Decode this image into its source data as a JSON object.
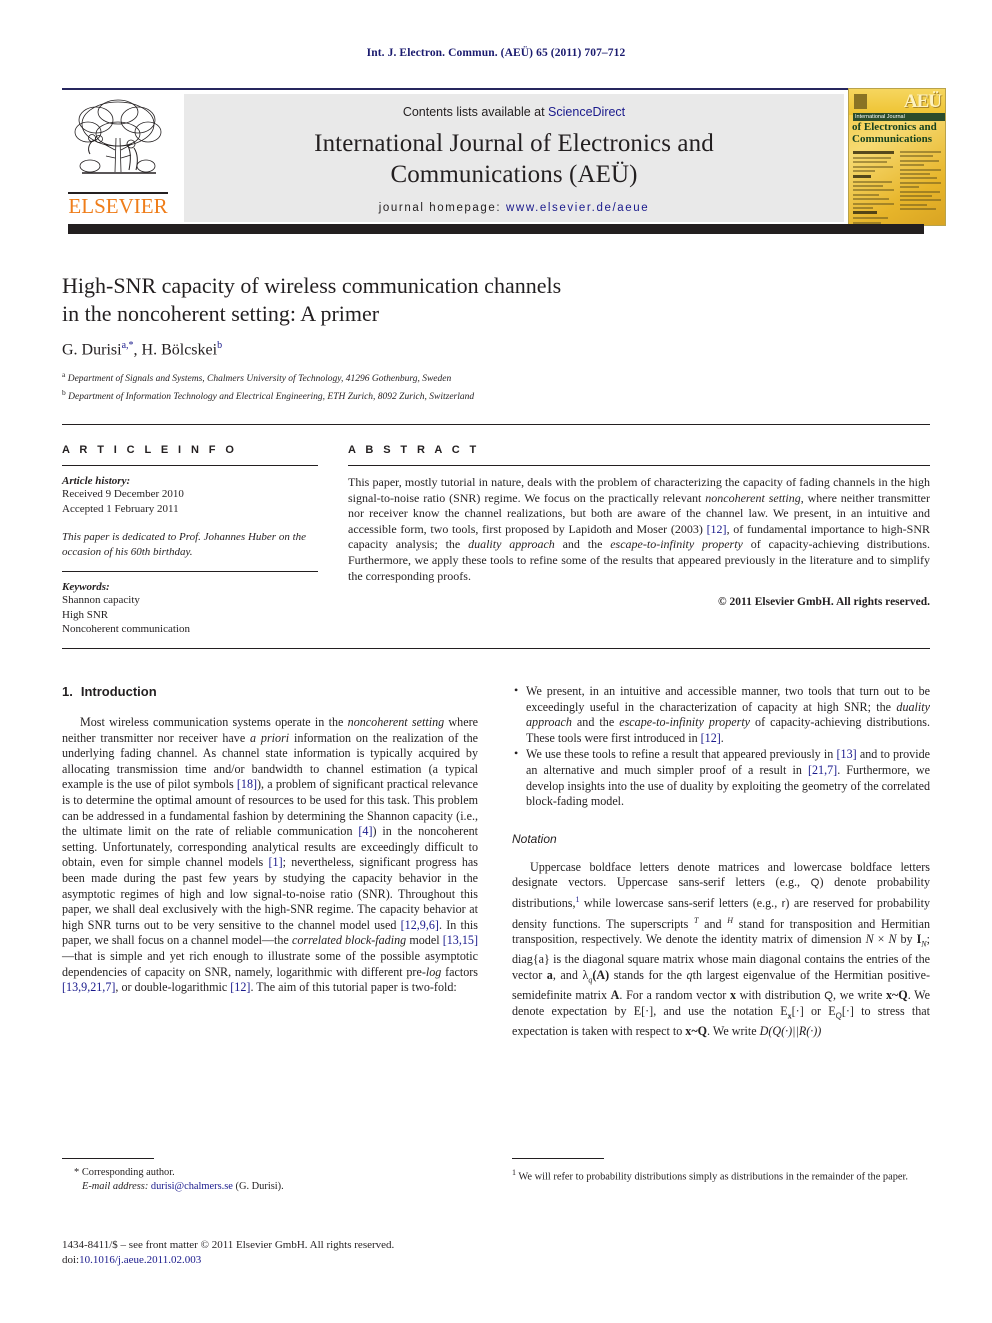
{
  "running_head": "Int. J. Electron. Commun. (AEÜ) 65 (2011) 707–712",
  "masthead": {
    "contents_prefix": "Contents lists available at ",
    "sciencedirect": "ScienceDirect",
    "journal_title_line1": "International Journal of Electronics and",
    "journal_title_line2": "Communications (AEÜ)",
    "homepage_prefix": "journal homepage: ",
    "homepage_url": "www.elsevier.de/aeue",
    "publisher_wordmark": "ELSEVIER",
    "cover": {
      "logo_text": "AEÜ",
      "banner_text": "International Journal",
      "title_line1": "of Electronics and",
      "title_line2": "Communications",
      "contents_label": "Contents"
    }
  },
  "article": {
    "title_line1": "High-SNR capacity of wireless communication channels",
    "title_line2": "in the noncoherent setting: A primer",
    "authors": "G. Durisi",
    "author_sup_a": "a,*",
    "authors_cont": ", H. Bölcskei",
    "author_sup_b": "b",
    "affiliation_a_sup": "a",
    "affiliation_a": "Department of Signals and Systems, Chalmers University of Technology, 41296 Gothenburg, Sweden",
    "affiliation_b_sup": "b",
    "affiliation_b": "Department of Information Technology and Electrical Engineering, ETH Zurich, 8092 Zurich, Switzerland"
  },
  "info": {
    "heading": "A R T I C L E    I N F O",
    "history_label": "Article history:",
    "received": "Received 9 December 2010",
    "accepted": "Accepted 1 February 2011",
    "dedication": "This paper is dedicated to Prof. Johannes Huber on the occasion of his 60th birthday.",
    "keywords_label": "Keywords:",
    "keywords": [
      "Shannon capacity",
      "High SNR",
      "Noncoherent communication"
    ]
  },
  "abstract": {
    "heading": "A B S T R A C T",
    "p1_a": "This paper, mostly tutorial in nature, deals with the problem of characterizing the capacity of fading channels in the high signal-to-noise ratio (SNR) regime. We focus on the practically relevant ",
    "p1_i1": "noncoherent setting",
    "p1_b": ", where neither transmitter nor receiver know the channel realizations, but both are aware of the channel law. We present, in an intuitive and accessible form, two tools, first proposed by Lapidoth and Moser (2003) ",
    "p1_ref1": "[12]",
    "p1_c": ", of fundamental importance to high-SNR capacity analysis; the ",
    "p1_i2": "duality approach",
    "p1_d": " and the ",
    "p1_i3": "escape-to-infinity property",
    "p1_e": " of capacity-achieving distributions. Furthermore, we apply these tools to refine some of the results that appeared previously in the literature and to simplify the corresponding proofs.",
    "copyright": "© 2011 Elsevier GmbH. All rights reserved."
  },
  "intro": {
    "number": "1.",
    "heading": "Introduction",
    "p1_a": "Most wireless communication systems operate in the ",
    "p1_i1": "noncoherent setting",
    "p1_b": " where neither transmitter nor receiver have ",
    "p1_i2": "a priori",
    "p1_c": " information on the realization of the underlying fading channel. As channel state information is typically acquired by allocating transmission time and/or bandwidth to channel estimation (a typical example is the use of pilot symbols ",
    "p1_ref18": "[18]",
    "p1_d": "), a problem of significant practical relevance is to determine the optimal amount of resources to be used for this task. This problem can be addressed in a fundamental fashion by determining the Shannon capacity (i.e., the ultimate limit on the rate of reliable communication ",
    "p1_ref4": "[4]",
    "p1_e": ") in the noncoherent setting. Unfortunately, corresponding analytical results are exceedingly difficult to obtain, even for simple channel models ",
    "p1_ref1": "[1]",
    "p1_f": "; nevertheless, significant progress has been made during the past few years by studying the capacity behavior in the asymptotic regimes of high and low signal-to-noise ratio (SNR). Throughout this paper, we shall deal exclusively with the high-SNR regime. The capacity behavior at high SNR turns out to be very sensitive to the channel model used ",
    "p1_ref1296": "[12,9,6]",
    "p1_g": ". In this paper, we shall focus on a channel model—the ",
    "p1_i3": "correlated block-fading",
    "p1_h": " model ",
    "p1_ref1315": "[13,15]",
    "p1_j": "—that is simple and yet rich enough to illustrate some of the possible asymptotic dependencies of capacity on SNR, namely, logarithmic with different pre-",
    "p1_i4": "log",
    "p1_k": " factors ",
    "p1_ref13921": "[13,9,21,7]",
    "p1_l": ", or double-logarithmic ",
    "p1_ref12b": "[12]",
    "p1_m": ". The aim of this tutorial paper is two-fold:"
  },
  "bullets": [
    {
      "a": "We present, in an intuitive and accessible manner, two tools that turn out to be exceedingly useful in the characterization of capacity at high SNR; the ",
      "i1": "duality approach",
      "b": " and the ",
      "i2": "escape-to-infinity property",
      "c": " of capacity-achieving distributions. These tools were first introduced in ",
      "ref1": "[12]",
      "d": "."
    },
    {
      "a": "We use these tools to refine a result that appeared previously in ",
      "ref1": "[13]",
      "b": " and to provide an alternative and much simpler proof of a result in ",
      "ref2": "[21,7]",
      "c": ". Furthermore, we develop insights into the use of duality by exploiting the geometry of the correlated block-fading model.",
      "i1": "",
      "i2": "",
      "d": ""
    }
  ],
  "notation": {
    "heading": "Notation",
    "p_a": "Uppercase boldface letters denote matrices and lowercase boldface letters designate vectors. Uppercase sans-serif letters (e.g., ",
    "sym_Q": "Q",
    "p_b": ") denote probability distributions,",
    "fn_marker": "1",
    "p_c": " while lowercase sans-serif letters (e.g., ",
    "sym_r": "r",
    "p_d": ") are reserved for probability density functions. The superscripts ",
    "sym_T": "T",
    "p_e": " and ",
    "sym_H": "H",
    "p_f": " stand for transposition and Hermitian transposition, respectively. We denote the identity matrix of dimension ",
    "sym_N1": "N",
    "p_g": " × ",
    "sym_N2": "N",
    "p_h": " by ",
    "sym_IN": "I",
    "sym_IN_sub": "N",
    "p_i": "; diag{a} is the diagonal square matrix whose main diagonal contains the entries of the vector ",
    "sym_a": "a",
    "p_j": ", and ",
    "sym_lambda": "λ",
    "sym_lambda_sub": "q",
    "sym_A1": "(A)",
    "p_k": " stands for the ",
    "sym_qth": "q",
    "p_l": "th largest eigenvalue of the Hermitian positive-semidefinite matrix ",
    "sym_A2": "A",
    "p_m": ". For a random vector ",
    "sym_x1": "x",
    "p_n": " with distribution ",
    "sym_Q2": "Q",
    "p_o": ", we write ",
    "sym_xQ": "x~Q",
    "p_p": ". We denote expectation by ",
    "sym_E1": "E[·]",
    "p_q": ", and use the notation ",
    "sym_E2": "E",
    "sym_E2_sub": "x",
    "sym_E2b": "[·]",
    "p_r": " or ",
    "sym_E3": "E",
    "sym_E3_sub": "Q",
    "sym_E3b": "[·]",
    "p_s": " to stress that expectation is taken with respect to ",
    "sym_xQ2": "x~Q",
    "p_t": ". We write ",
    "sym_D": "D(Q(·)||R(·))"
  },
  "footnotes": {
    "corresponding_marker": "*",
    "corresponding_label": "Corresponding author.",
    "email_label": "E-mail address:",
    "email": "durisi@chalmers.se",
    "email_suffix": "(G. Durisi).",
    "right_marker": "1",
    "right_text": "We will refer to probability distributions simply as distributions in the remainder of the paper."
  },
  "issn": {
    "line1": "1434-8411/$ – see front matter © 2011 Elsevier GmbH. All rights reserved.",
    "doi_label": "doi:",
    "doi_value": "10.1016/j.aeue.2011.02.003"
  },
  "colors": {
    "link": "#1a1a8c",
    "running_head": "#1a1a6e",
    "elsevier_orange": "#ef7d1a",
    "dark_bar": "#231f20",
    "band_gray": "#e9e9e9"
  }
}
